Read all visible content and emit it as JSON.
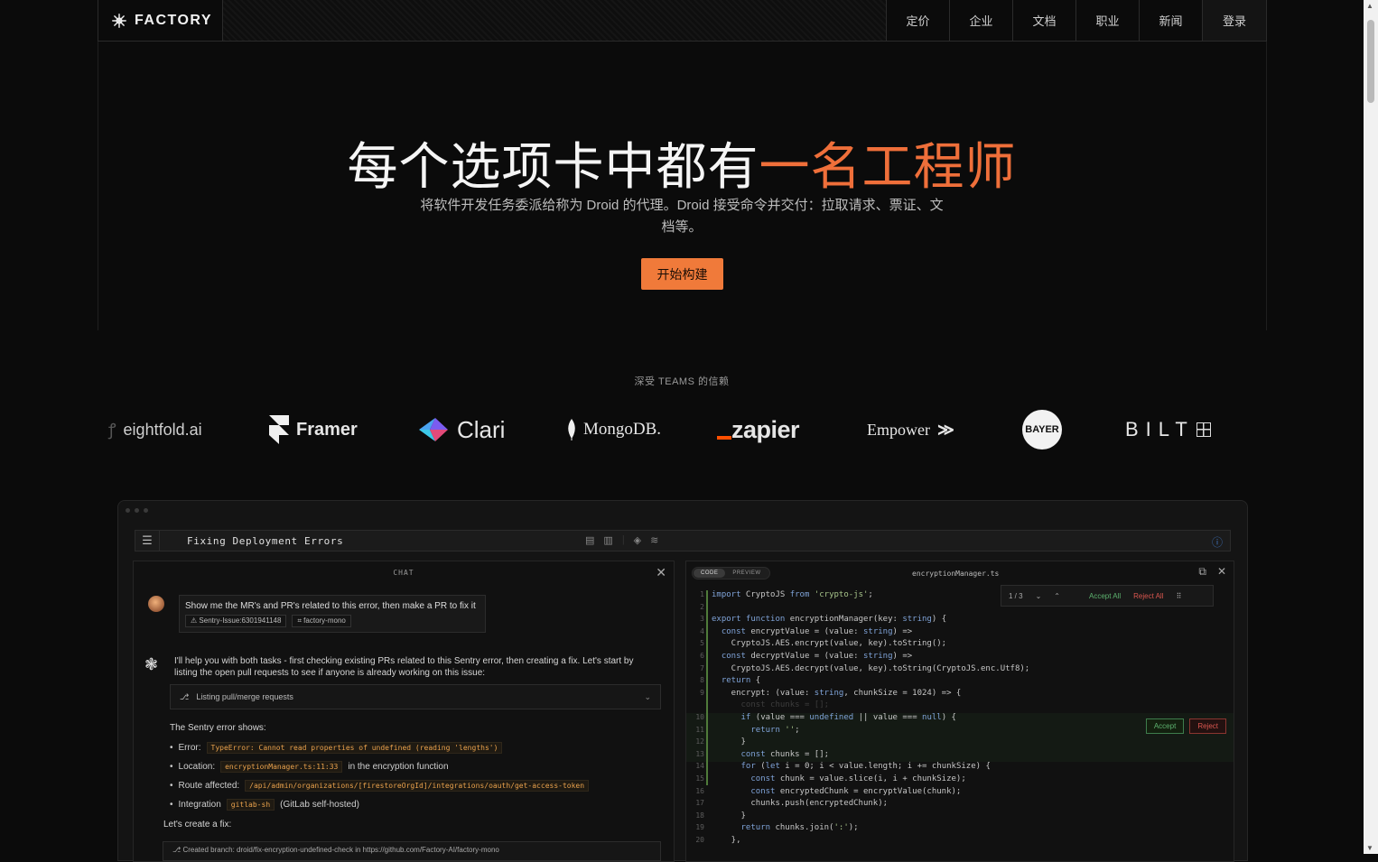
{
  "nav": {
    "brand": "FACTORY",
    "links": [
      {
        "label": "定价"
      },
      {
        "label": "企业"
      },
      {
        "label": "文档"
      },
      {
        "label": "职业"
      },
      {
        "label": "新闻"
      },
      {
        "label": "登录"
      }
    ]
  },
  "hero": {
    "title_main": "每个选项卡中都有",
    "title_accent": "一名工程师",
    "subtitle": "将软件开发任务委派给称为 Droid 的代理。Droid 接受命令并交付：拉取请求、票证、文档等。",
    "cta": "开始构建",
    "accent_color": "#ef6f3a"
  },
  "trust": {
    "label": "深受 TEAMS 的信赖",
    "logos": [
      {
        "name": "eightfold.ai"
      },
      {
        "name": "Framer"
      },
      {
        "name": "Clari"
      },
      {
        "name": "MongoDB."
      },
      {
        "name": "zapier"
      },
      {
        "name": "Empower"
      },
      {
        "name": "BAYER"
      },
      {
        "name": "BILT"
      }
    ]
  },
  "app": {
    "toolbar_title": "Fixing Deployment Errors",
    "chat": {
      "header": "CHAT",
      "user_message": "Show me the MR's and PR's related to this error, then make a PR to fix it",
      "chips": [
        "Sentry-Issue:6301941148",
        "factory-mono"
      ],
      "droid_message": "I'll help you with both tasks - first checking existing PRs related to this Sentry error, then creating a fix. Let's start by listing the open pull requests to see if anyone is already working on this issue:",
      "tool_call": "Listing pull/merge requests",
      "error_heading": "The Sentry error shows:",
      "bullets": [
        {
          "label": "Error:",
          "code": "TypeError: Cannot read properties of undefined (reading 'lengths')",
          "suffix": ""
        },
        {
          "label": "Location:",
          "code": "encryptionManager.ts:11:33",
          "suffix": "in the encryption function"
        },
        {
          "label": "Route affected:",
          "code": "/api/admin/organizations/[firestoreOrgId]/integrations/oauth/get-access-token",
          "suffix": ""
        },
        {
          "label": "Integration",
          "code": "gitlab-sh",
          "suffix": "(GitLab self-hosted)"
        }
      ],
      "fix_line": "Let's create a fix:",
      "branch_line": "Created branch: droid/fix-encryption-undefined-check in https://github.com/Factory-AI/factory-mono"
    },
    "code": {
      "tabs": [
        "CODE",
        "PREVIEW"
      ],
      "filename": "encryptionManager.ts",
      "diff_nav": "1 / 3",
      "accept_all": "Accept All",
      "reject_all": "Reject All",
      "accept": "Accept",
      "reject": "Reject",
      "lines": [
        {
          "n": "1",
          "t": "import CryptoJS from 'crypto-js';"
        },
        {
          "n": "2",
          "t": ""
        },
        {
          "n": "3",
          "t": "export function encryptionManager(key: string) {"
        },
        {
          "n": "4",
          "t": "  const encryptValue = (value: string) =>"
        },
        {
          "n": "5",
          "t": "    CryptoJS.AES.encrypt(value, key).toString();"
        },
        {
          "n": "6",
          "t": "  const decryptValue = (value: string) =>"
        },
        {
          "n": "7",
          "t": "    CryptoJS.AES.decrypt(value, key).toString(CryptoJS.enc.Utf8);"
        },
        {
          "n": "8",
          "t": "  return {"
        },
        {
          "n": "9",
          "t": "    encrypt: (value: string, chunkSize = 1024) => {"
        },
        {
          "n": "",
          "t": "      const chunks = [];",
          "ghost": true
        },
        {
          "n": "10",
          "t": "      if (value === undefined || value === null) {"
        },
        {
          "n": "11",
          "t": "        return '';"
        },
        {
          "n": "12",
          "t": "      }"
        },
        {
          "n": "13",
          "t": "      const chunks = [];"
        },
        {
          "n": "14",
          "t": "      for (let i = 0; i < value.length; i += chunkSize) {"
        },
        {
          "n": "15",
          "t": "        const chunk = value.slice(i, i + chunkSize);"
        },
        {
          "n": "16",
          "t": "        const encryptedChunk = encryptValue(chunk);"
        },
        {
          "n": "17",
          "t": "        chunks.push(encryptedChunk);"
        },
        {
          "n": "18",
          "t": "      }"
        },
        {
          "n": "19",
          "t": "      return chunks.join(':');"
        },
        {
          "n": "20",
          "t": "    },"
        }
      ]
    }
  }
}
